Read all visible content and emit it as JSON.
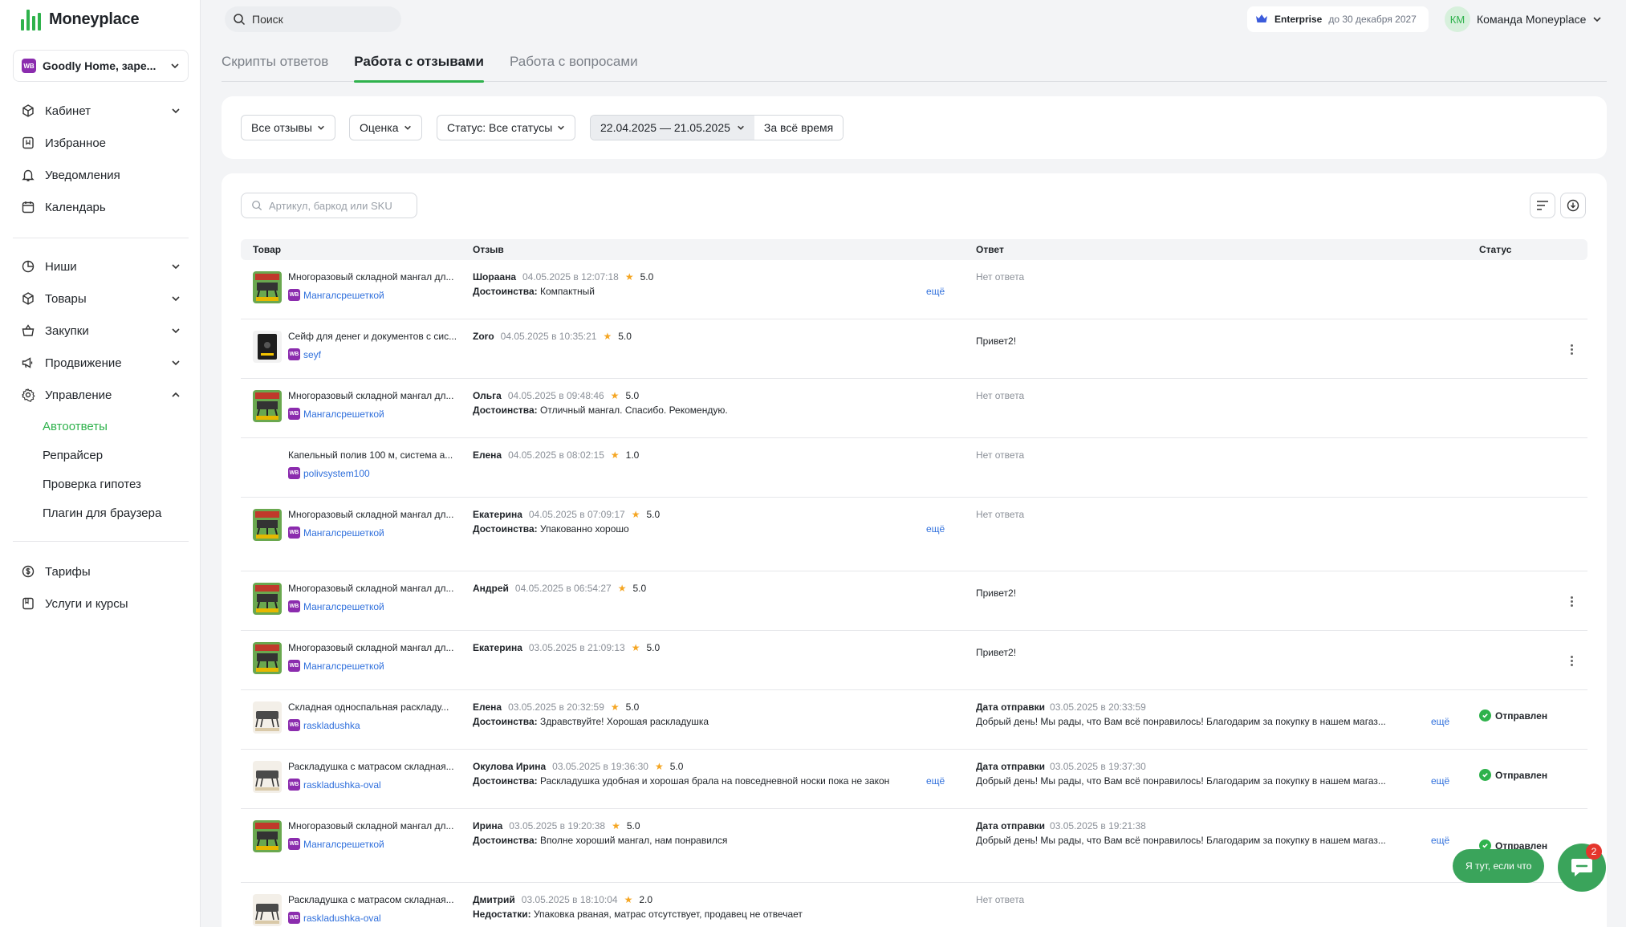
{
  "app": {
    "logo_text": "Moneyplace"
  },
  "account": {
    "badge": "WB",
    "name": "Goodly Home, заре..."
  },
  "nav": {
    "group1": [
      {
        "label": "Кабинет",
        "icon": "cube-icon",
        "chevron": "down"
      },
      {
        "label": "Избранное",
        "icon": "bookmark-icon"
      },
      {
        "label": "Уведомления",
        "icon": "bell-icon"
      },
      {
        "label": "Календарь",
        "icon": "calendar-icon"
      }
    ],
    "group2": [
      {
        "label": "Ниши",
        "icon": "pie-chart-icon",
        "chevron": "down"
      },
      {
        "label": "Товары",
        "icon": "box-icon",
        "chevron": "down"
      },
      {
        "label": "Закупки",
        "icon": "basket-icon",
        "chevron": "down"
      },
      {
        "label": "Продвижение",
        "icon": "megaphone-icon",
        "chevron": "down"
      },
      {
        "label": "Управление",
        "icon": "gear-icon",
        "chevron": "up"
      }
    ],
    "sub": [
      {
        "label": "Автоответы",
        "active": true
      },
      {
        "label": "Репрайсер"
      },
      {
        "label": "Проверка гипотез"
      },
      {
        "label": "Плагин для браузера"
      }
    ],
    "group3": [
      {
        "label": "Тарифы",
        "icon": "dollar-icon"
      },
      {
        "label": "Услуги и курсы",
        "icon": "book-icon"
      }
    ]
  },
  "topbar": {
    "search_placeholder": "Поиск",
    "plan_name": "Enterprise",
    "plan_until": "до 30 декабря 2027",
    "avatar_initials": "КМ",
    "team_name": "Команда Moneyplace"
  },
  "tabs": [
    "Скрипты ответов",
    "Работа с отзывами",
    "Работа с вопросами"
  ],
  "filters": {
    "all_reviews": "Все отзывы",
    "rating": "Оценка",
    "status": "Статус: Все статусы",
    "date_range": "22.04.2025 — 21.05.2025",
    "all_time": "За всё время"
  },
  "table": {
    "search_placeholder": "Артикул, баркод или SKU",
    "columns": [
      "Товар",
      "Отзыв",
      "Ответ",
      "Статус"
    ],
    "more_label": "ещё",
    "no_answer": "Нет ответа",
    "send_date_label": "Дата отправки",
    "status_sent": "Отправлен",
    "rows": [
      {
        "product": "Многоразовый складной мангал дл...",
        "sku": "Мангалсрешеткой",
        "thumb": "grill",
        "author": "Шораана",
        "date": "04.05.2025 в 12:07:18",
        "rating": "5.0",
        "body_label": "Достоинства:",
        "body": "Компактный",
        "has_more": true,
        "answer_type": "none"
      },
      {
        "product": "Сейф для денег и документов с сис...",
        "sku": "seyf",
        "thumb": "safe",
        "author": "Zoro",
        "date": "04.05.2025 в 10:35:21",
        "rating": "5.0",
        "body_label": "",
        "body": "",
        "has_more": false,
        "answer_type": "text",
        "answer": "Привет2!",
        "kebab": true
      },
      {
        "product": "Многоразовый складной мангал дл...",
        "sku": "Мангалсрешеткой",
        "thumb": "grill",
        "author": "Ольга",
        "date": "04.05.2025 в 09:48:46",
        "rating": "5.0",
        "body_label": "Достоинства:",
        "body": "Отличный мангал. Спасибо. Рекомендую.",
        "has_more": false,
        "answer_type": "none"
      },
      {
        "product": "Капельный полив 100 м, система а...",
        "sku": "polivsystem100",
        "thumb": "",
        "author": "Елена",
        "date": "04.05.2025 в 08:02:15",
        "rating": "1.0",
        "body_label": "",
        "body": "",
        "has_more": false,
        "answer_type": "none"
      },
      {
        "product": "Многоразовый складной мангал дл...",
        "sku": "Мангалсрешеткой",
        "thumb": "grill",
        "author": "Екатерина",
        "date": "04.05.2025 в 07:09:17",
        "rating": "5.0",
        "body_label": "Достоинства:",
        "body": "Упакованно хорошо",
        "has_more": true,
        "answer_type": "none"
      },
      {
        "product": "Многоразовый складной мангал дл...",
        "sku": "Мангалсрешеткой",
        "thumb": "grill",
        "author": "Андрей",
        "date": "04.05.2025 в 06:54:27",
        "rating": "5.0",
        "body_label": "",
        "body": "",
        "has_more": false,
        "answer_type": "text",
        "answer": "Привет2!",
        "kebab": true
      },
      {
        "product": "Многоразовый складной мангал дл...",
        "sku": "Мангалсрешеткой",
        "thumb": "grill",
        "author": "Екатерина",
        "date": "03.05.2025 в 21:09:13",
        "rating": "5.0",
        "body_label": "",
        "body": "",
        "has_more": false,
        "answer_type": "text",
        "answer": "Привет2!",
        "kebab": true
      },
      {
        "product": "Складная односпальная раскладу...",
        "sku": "raskladushka",
        "thumb": "bed",
        "author": "Елена",
        "date": "03.05.2025 в 20:32:59",
        "rating": "5.0",
        "body_label": "Достоинства:",
        "body": "Здравствуйте! Хорошая раскладушка",
        "has_more": false,
        "answer_type": "sent",
        "answer_date": "03.05.2025 в 20:33:59",
        "answer": "Добрый день! Мы рады, что Вам всё понравилось! Благодарим за покупку в нашем магаз..."
      },
      {
        "product": "Раскладушка с матрасом складная...",
        "sku": "raskladushka-oval",
        "thumb": "bed",
        "author": "Окулова Ирина",
        "date": "03.05.2025 в 19:36:30",
        "rating": "5.0",
        "body_label": "Достоинства:",
        "body": "Раскладушка удобная и хорошая брала на повседневной носки пока не закон",
        "has_more": true,
        "answer_type": "sent",
        "answer_date": "03.05.2025 в 19:37:30",
        "answer": "Добрый день! Мы рады, что Вам всё понравилось! Благодарим за покупку в нашем магаз..."
      },
      {
        "product": "Многоразовый складной мангал дл...",
        "sku": "Мангалсрешеткой",
        "thumb": "grill",
        "author": "Ирина",
        "date": "03.05.2025 в 19:20:38",
        "rating": "5.0",
        "body_label": "Достоинства:",
        "body": "Вполне хороший мангал, нам понравился",
        "has_more": false,
        "answer_type": "sent",
        "answer_date": "03.05.2025 в 19:21:38",
        "answer": "Добрый день! Мы рады, что Вам всё понравилось! Благодарим за покупку в нашем магаз..."
      },
      {
        "product": "Раскладушка с матрасом складная...",
        "sku": "raskladushka-oval",
        "thumb": "bed",
        "author": "Дмитрий",
        "date": "03.05.2025 в 18:10:04",
        "rating": "2.0",
        "body_label": "Недостатки:",
        "body": "Упаковка рваная, матрас отсутствует, продавец не отвечает",
        "has_more": false,
        "answer_type": "none"
      }
    ]
  },
  "chat": {
    "pill_text": "Я тут, если что",
    "badge_count": "2"
  }
}
